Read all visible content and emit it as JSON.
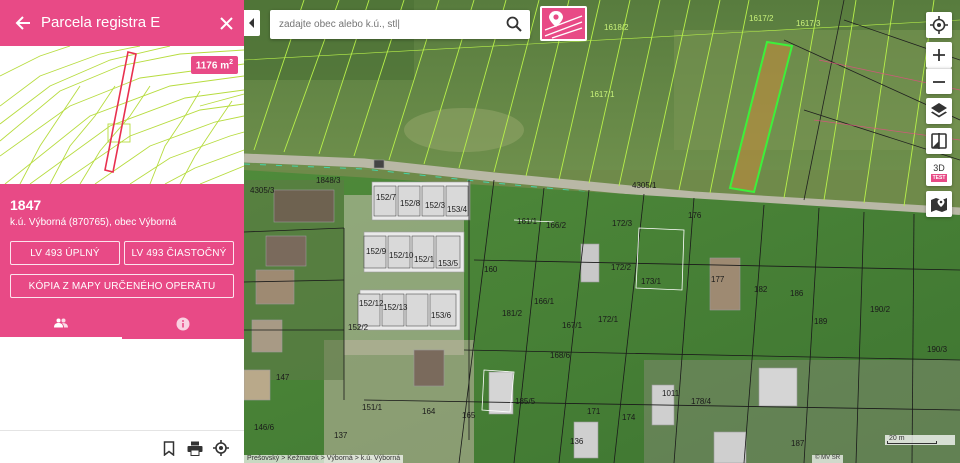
{
  "panel": {
    "title": "Parcela registra E",
    "area_value": "1176 m",
    "area_unit_sup": "2",
    "parcel_number": "1847",
    "location": "k.ú. Výborná (870765), obec Výborná",
    "buttons": {
      "lv_full": "LV 493 úplný",
      "lv_partial": "LV 493 čiastočný",
      "copy_map": "Kópia z mapy určeného operátu"
    },
    "tabs": [
      {
        "id": "owners",
        "icon": "people-icon",
        "active": true
      },
      {
        "id": "info",
        "icon": "info-icon",
        "active": false
      }
    ],
    "footer_icons": [
      "bookmark-icon",
      "print-icon",
      "locate-icon"
    ]
  },
  "search": {
    "placeholder": "zadajte obec alebo k.ú., stl|"
  },
  "controls": {
    "view_3d": "3D",
    "view_3d_badge": "TEST"
  },
  "map_labels": {
    "top": [
      "1617/2",
      "1617/3",
      "1617/1",
      "1618/2"
    ],
    "road": "4305/1",
    "parcels": [
      "4305/3",
      "1848/3",
      "152/7",
      "152/8",
      "152/3",
      "153/4",
      "152/9",
      "152/10",
      "152/1",
      "153/5",
      "152/12",
      "152/13",
      "153/6",
      "152/2",
      "161/1",
      "166/2",
      "172/3",
      "176",
      "172/2",
      "173/1",
      "177",
      "182",
      "166/1",
      "167/1",
      "172/1",
      "186",
      "189",
      "190/2",
      "190/3",
      "160",
      "181/2",
      "151/1",
      "164",
      "165",
      "171",
      "174",
      "187",
      "178/4",
      "1011",
      "185/5",
      "168/6",
      "136",
      "147",
      "146/6",
      "137"
    ]
  },
  "scale_label": "20 m",
  "breadcrumb": "Prešovský > Kežmarok > Výborná > k.ú. Výborná",
  "copyright": "© MV SR",
  "colors": {
    "accent": "#e84a86",
    "parcel_line": "#b7f04a",
    "selected_parcel": "#3df03a"
  }
}
